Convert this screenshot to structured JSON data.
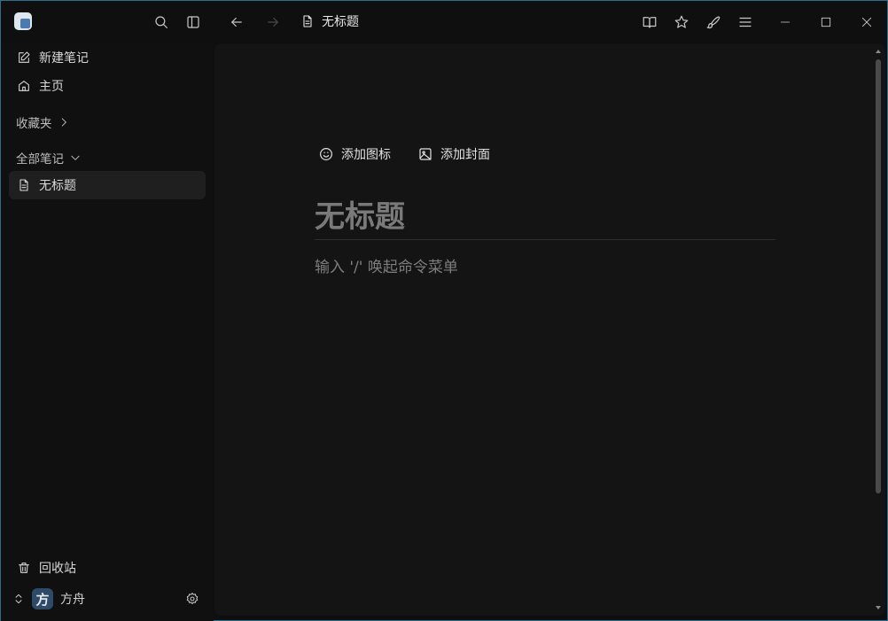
{
  "window": {
    "document_title": "无标题",
    "controls": {
      "minimize": "minimize",
      "maximize": "maximize",
      "close": "close"
    }
  },
  "sidebar": {
    "new_note": "新建笔记",
    "home": "主页",
    "favorites": "收藏夹",
    "all_notes": "全部笔记",
    "notes": [
      {
        "label": "无标题"
      }
    ],
    "trash": "回收站",
    "user": {
      "avatar_letter": "方",
      "name": "方舟"
    }
  },
  "editor": {
    "add_icon": "添加图标",
    "add_cover": "添加封面",
    "title_placeholder": "无标题",
    "body_placeholder": "输入 '/' 唤起命令菜单"
  },
  "colors": {
    "background": "#0f0f0f",
    "editor_background": "#141414",
    "active_item": "#1f1f1f",
    "accent": "#4a7ab0"
  }
}
